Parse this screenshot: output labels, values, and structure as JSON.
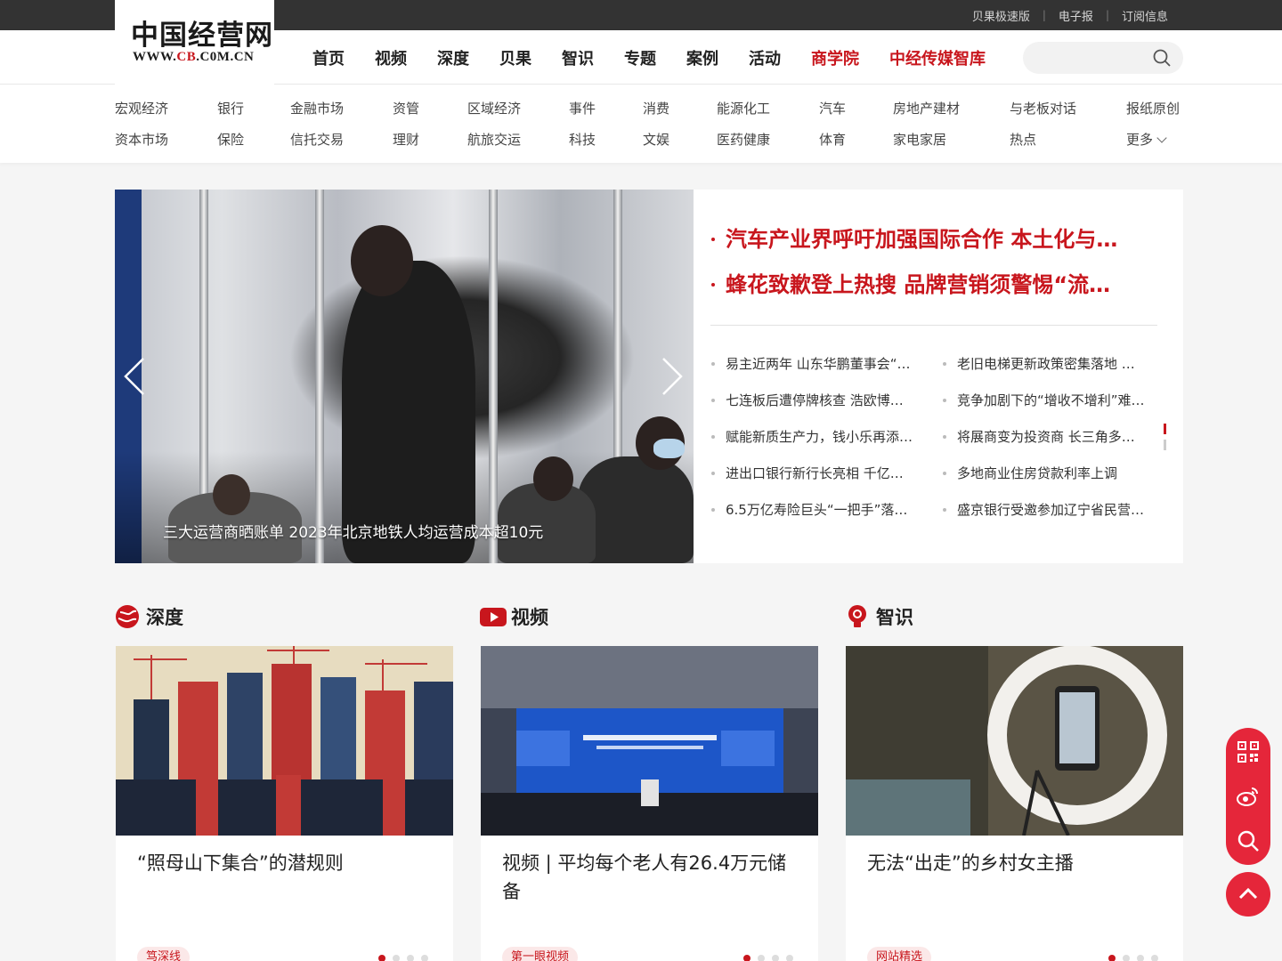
{
  "topbar": {
    "links": [
      "贝果极速版",
      "电子报",
      "订阅信息"
    ]
  },
  "logo": {
    "cn": "中国经营网",
    "url_pre": "WWW.",
    "url_mid": "CB",
    "url_post": ".C0M.CN"
  },
  "mainnav": [
    "首页",
    "视频",
    "深度",
    "贝果",
    "智识",
    "专题",
    "案例",
    "活动",
    "商学院",
    "中经传媒智库"
  ],
  "search": {
    "placeholder": ""
  },
  "categories": {
    "row1": [
      "宏观经济",
      "银行",
      "金融市场",
      "资管",
      "区域经济",
      "事件",
      "消费",
      "能源化工",
      "汽车",
      "房地产建材",
      "与老板对话",
      "报纸原创"
    ],
    "row2": [
      "资本市场",
      "保险",
      "信托交易",
      "理财",
      "航旅交运",
      "科技",
      "文娱",
      "医药健康",
      "体育",
      "家电家居",
      "热点",
      "更多"
    ]
  },
  "hero": {
    "caption": "三大运营商晒账单 2023年北京地铁人均运营成本超10元"
  },
  "headlines": {
    "big": [
      "汽车产业界呼吁加强国际合作 本土化与…",
      "蜂花致歉登上热搜 品牌营销须警惕“流…"
    ],
    "left": [
      "易主近两年 山东华鹏董事会“…",
      "七连板后遭停牌核查 浩欧博…",
      "赋能新质生产力，钱小乐再添…",
      "进出口银行新行长亮相 千亿…",
      "6.5万亿寿险巨头“一把手”落…"
    ],
    "right": [
      "老旧电梯更新政策密集落地 …",
      "竞争加剧下的“增收不增利”难…",
      "将展商变为投资商 长三角多…",
      "多地商业住房贷款利率上调",
      "盛京银行受邀参加辽宁省民营…"
    ]
  },
  "sections": [
    {
      "title": "深度",
      "card_title": "“照母山下集合”的潜规则",
      "tag": "笃深线",
      "icon": "globe-icon"
    },
    {
      "title": "视频",
      "card_title": "视频 | 平均每个老人有26.4万元储备",
      "tag": "第一眼视频",
      "icon": "play-icon"
    },
    {
      "title": "智识",
      "card_title": "无法“出走”的乡村女主播",
      "tag": "网站精选",
      "icon": "bulb-icon"
    }
  ],
  "float_toolbar": [
    "qrcode-icon",
    "weibo-icon",
    "search-icon"
  ],
  "colors": {
    "brand_red": "#c8161d",
    "float_red": "#e5263a",
    "topbar": "#333333"
  }
}
